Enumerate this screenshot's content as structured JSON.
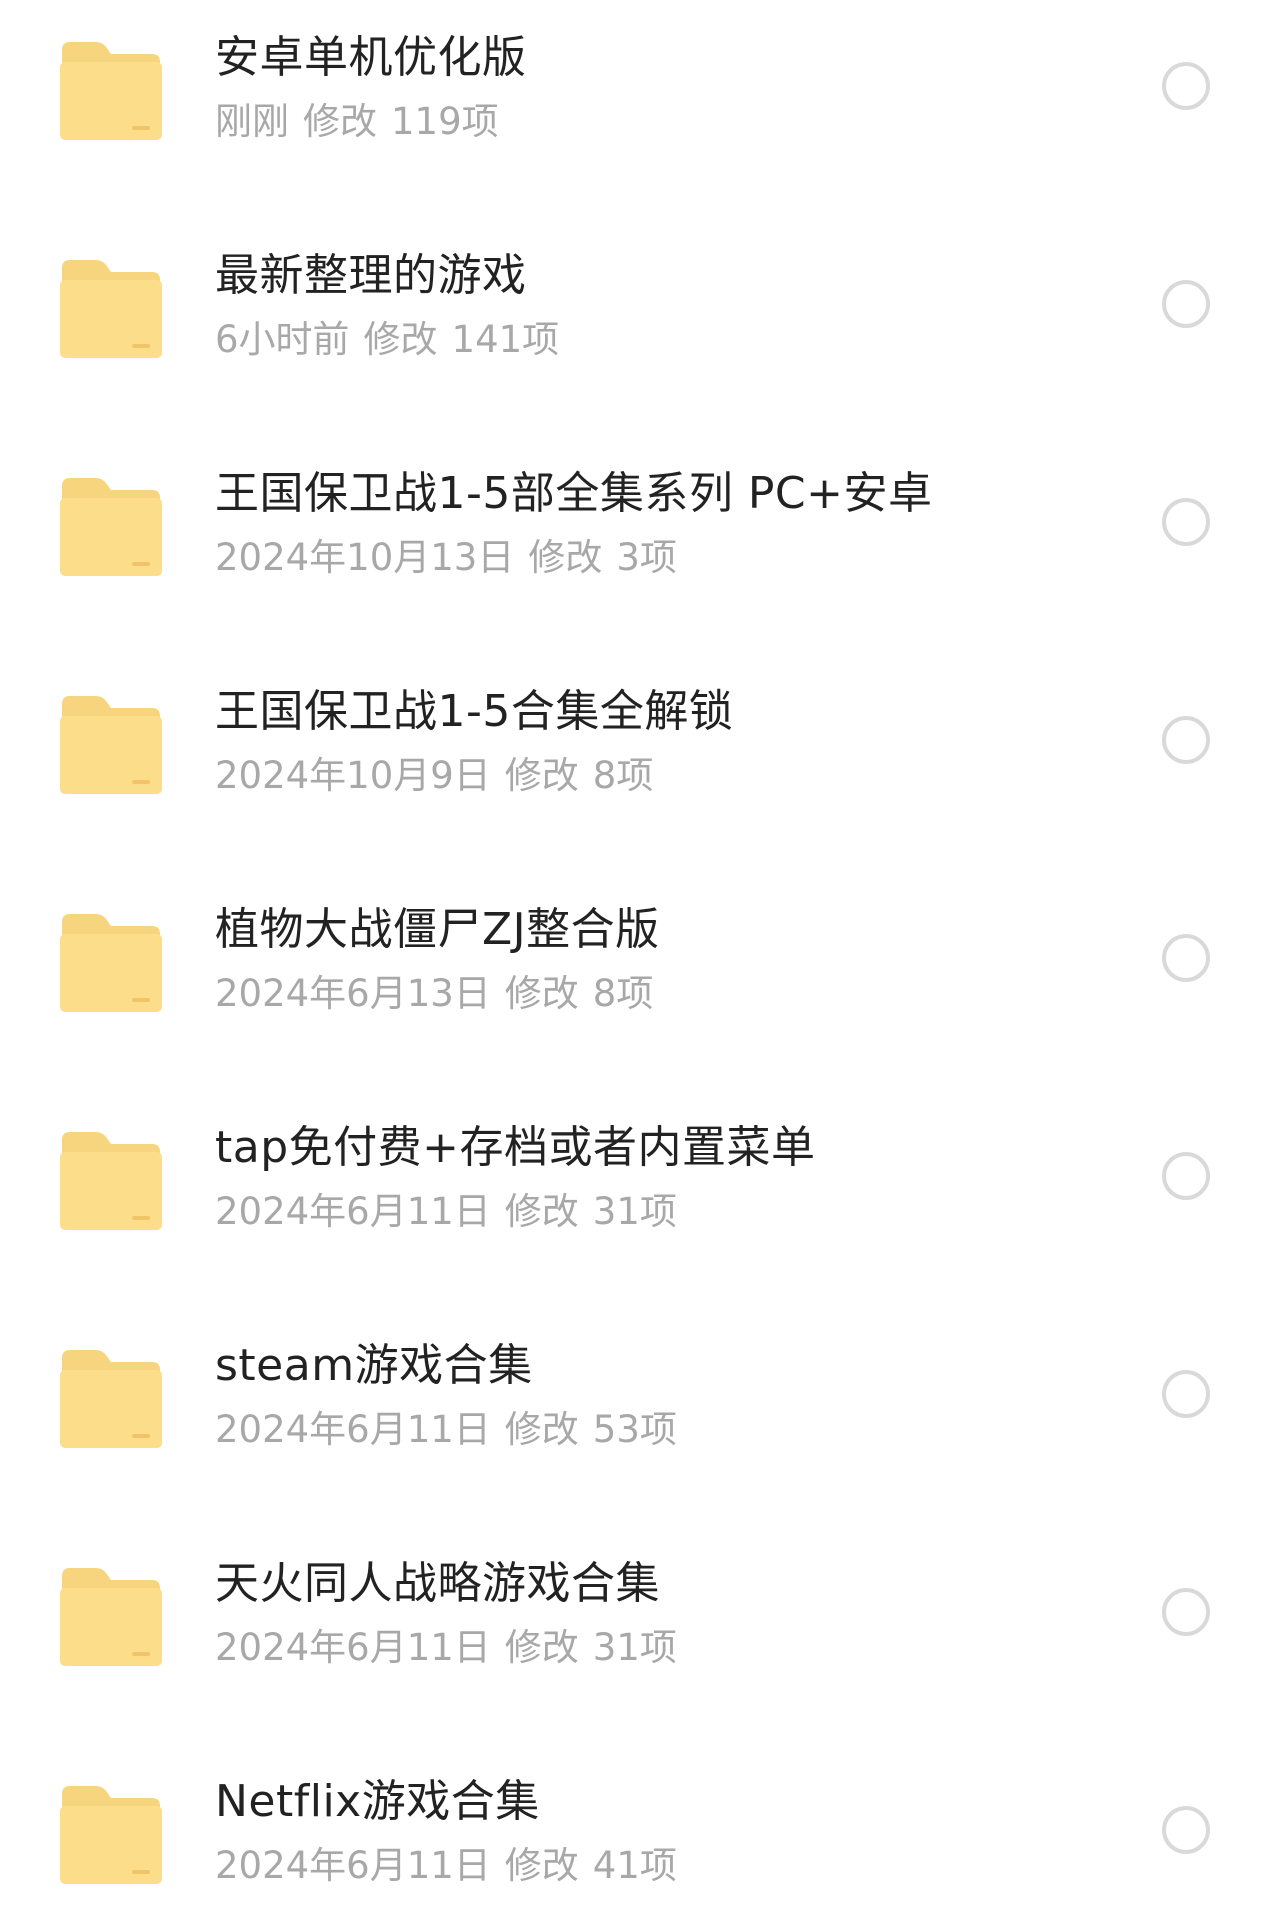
{
  "colors": {
    "folder_back": "#F7D57F",
    "folder_front": "#FCDD8A",
    "folder_tab_accent": "#F2C46A",
    "name_text": "#222222",
    "meta_text": "#A8A8A8",
    "radio_border": "#D9D9D9"
  },
  "icons": {
    "folder": "folder-icon",
    "select": "radio-unchecked-icon"
  },
  "files": [
    {
      "name": "安卓单机优化版",
      "modified": "刚刚",
      "action": "修改",
      "count": "119项"
    },
    {
      "name": "最新整理的游戏",
      "modified": "6小时前",
      "action": "修改",
      "count": "141项"
    },
    {
      "name": "王国保卫战1-5部全集系列 PC+安卓",
      "modified": "2024年10月13日",
      "action": "修改",
      "count": "3项"
    },
    {
      "name": "王国保卫战1-5合集全解锁",
      "modified": "2024年10月9日",
      "action": "修改",
      "count": "8项"
    },
    {
      "name": "植物大战僵尸ZJ整合版",
      "modified": "2024年6月13日",
      "action": "修改",
      "count": "8项"
    },
    {
      "name": "tap免付费+存档或者内置菜单",
      "modified": "2024年6月11日",
      "action": "修改",
      "count": "31项"
    },
    {
      "name": "steam游戏合集",
      "modified": "2024年6月11日",
      "action": "修改",
      "count": "53项"
    },
    {
      "name": "天火同人战略游戏合集",
      "modified": "2024年6月11日",
      "action": "修改",
      "count": "31项"
    },
    {
      "name": "Netflix游戏合集",
      "modified": "2024年6月11日",
      "action": "修改",
      "count": "41项"
    }
  ]
}
